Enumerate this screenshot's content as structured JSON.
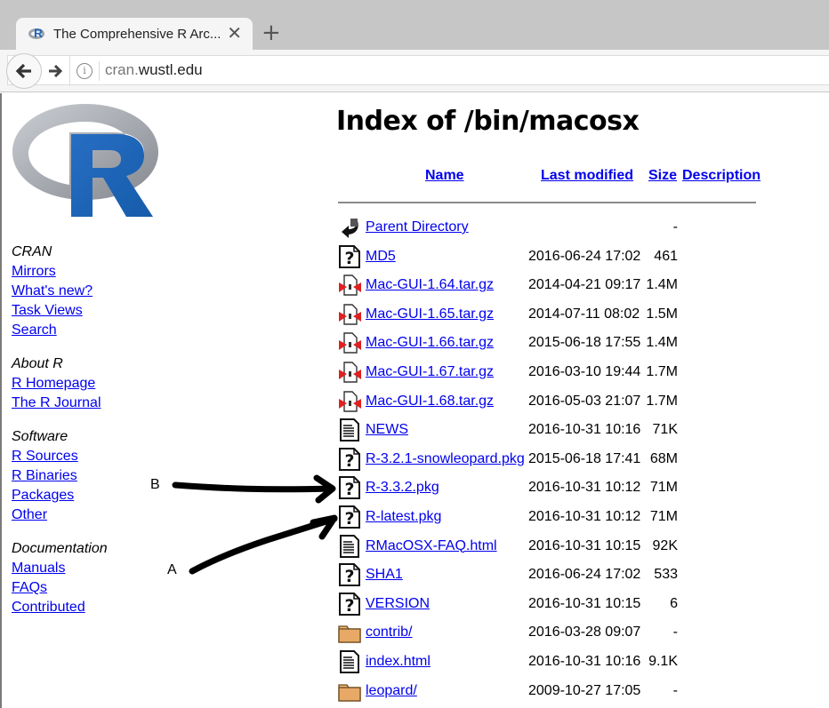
{
  "browser": {
    "tab_title": "The Comprehensive R Arc...",
    "url_subdomain": "cran.",
    "url_domain": "wustl.edu",
    "icons": [
      "r-favicon",
      "close-icon",
      "plus-icon",
      "back-arrow-icon",
      "forward-arrow-icon",
      "info-icon"
    ]
  },
  "page": {
    "title": "Index of /bin/macosx"
  },
  "sidebar": {
    "sections": [
      {
        "heading": "CRAN",
        "links": [
          "Mirrors",
          "What's new?",
          "Task Views",
          "Search"
        ]
      },
      {
        "heading": "About R",
        "links": [
          "R Homepage",
          "The R Journal"
        ]
      },
      {
        "heading": "Software",
        "links": [
          "R Sources",
          "R Binaries",
          "Packages",
          "Other"
        ]
      },
      {
        "heading": "Documentation",
        "links": [
          "Manuals",
          "FAQs",
          "Contributed"
        ]
      }
    ]
  },
  "listing": {
    "columns": {
      "name": "Name",
      "last_modified": "Last modified",
      "size": "Size",
      "description": "Description"
    },
    "rows": [
      {
        "icon": "back",
        "name": "Parent Directory",
        "date": "",
        "size": "-"
      },
      {
        "icon": "unknown",
        "name": "MD5",
        "date": "2016-06-24 17:02",
        "size": "461"
      },
      {
        "icon": "compressed",
        "name": "Mac-GUI-1.64.tar.gz",
        "date": "2014-04-21 09:17",
        "size": "1.4M"
      },
      {
        "icon": "compressed",
        "name": "Mac-GUI-1.65.tar.gz",
        "date": "2014-07-11 08:02",
        "size": "1.5M"
      },
      {
        "icon": "compressed",
        "name": "Mac-GUI-1.66.tar.gz",
        "date": "2015-06-18 17:55",
        "size": "1.4M"
      },
      {
        "icon": "compressed",
        "name": "Mac-GUI-1.67.tar.gz",
        "date": "2016-03-10 19:44",
        "size": "1.7M"
      },
      {
        "icon": "compressed",
        "name": "Mac-GUI-1.68.tar.gz",
        "date": "2016-05-03 21:07",
        "size": "1.7M"
      },
      {
        "icon": "text",
        "name": "NEWS",
        "date": "2016-10-31 10:16",
        "size": "71K"
      },
      {
        "icon": "unknown",
        "name": "R-3.2.1-snowleopard.pkg",
        "date": "2015-06-18 17:41",
        "size": "68M"
      },
      {
        "icon": "unknown",
        "name": "R-3.3.2.pkg",
        "date": "2016-10-31 10:12",
        "size": "71M"
      },
      {
        "icon": "unknown",
        "name": "R-latest.pkg",
        "date": "2016-10-31 10:12",
        "size": "71M"
      },
      {
        "icon": "text",
        "name": "RMacOSX-FAQ.html",
        "date": "2016-10-31 10:15",
        "size": "92K"
      },
      {
        "icon": "unknown",
        "name": "SHA1",
        "date": "2016-06-24 17:02",
        "size": "533"
      },
      {
        "icon": "unknown",
        "name": "VERSION",
        "date": "2016-10-31 10:15",
        "size": "6"
      },
      {
        "icon": "folder",
        "name": "contrib/",
        "date": "2016-03-28 09:07",
        "size": "-"
      },
      {
        "icon": "text",
        "name": "index.html",
        "date": "2016-10-31 10:16",
        "size": "9.1K"
      },
      {
        "icon": "folder",
        "name": "leopard/",
        "date": "2009-10-27 17:05",
        "size": "-"
      }
    ]
  },
  "annotations": {
    "label_a": "A",
    "label_b": "B",
    "arrow_a_target": "R-latest.pkg",
    "arrow_b_target": "R-3.3.2.pkg"
  },
  "colors": {
    "link": "#0000ee",
    "r_logo_blue": "#2165b6",
    "r_logo_gray": "#9ea3ab",
    "tabstrip": "#c6c6c6"
  }
}
